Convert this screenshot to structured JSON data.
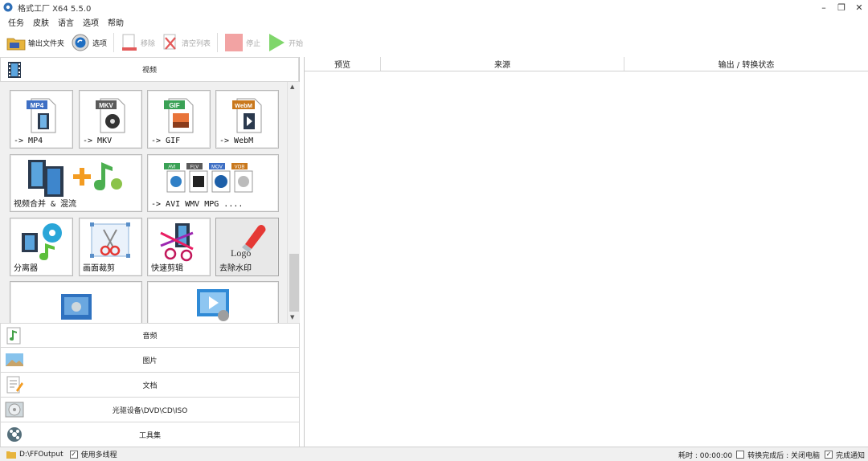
{
  "window": {
    "title": "格式工厂 X64 5.5.0",
    "controls": {
      "minimize": "–",
      "restore": "❐",
      "close": "✕"
    }
  },
  "menu": [
    "任务",
    "皮肤",
    "语言",
    "选项",
    "帮助"
  ],
  "toolbar": {
    "output_folder": "输出文件夹",
    "options": "选项",
    "remove": "移除",
    "clear_list": "清空列表",
    "stop": "停止",
    "start": "开始"
  },
  "sidebar": {
    "video_category": "视频",
    "tiles": [
      {
        "label": "-> MP4",
        "badge": "MP4",
        "badge_color": "#3e6fc4"
      },
      {
        "label": "-> MKV",
        "badge": "MKV",
        "badge_color": "#5a5a5a"
      },
      {
        "label": "-> GIF",
        "badge": "GIF",
        "badge_color": "#3aa155"
      },
      {
        "label": "-> WebM",
        "badge": "WebM",
        "badge_color": "#c9781c"
      },
      {
        "label": "视频合并 & 混流"
      },
      {
        "label": "-> AVI WMV MPG ....",
        "badges": [
          "AVI",
          "FLV",
          "MOV",
          "VOB"
        ]
      },
      {
        "label": "分离器"
      },
      {
        "label": "画面裁剪"
      },
      {
        "label": "快速剪辑"
      },
      {
        "label": "去除水印",
        "logo_text": "Logo"
      },
      {
        "label": ""
      },
      {
        "label": ""
      }
    ],
    "categories": [
      {
        "label": "音频",
        "icon": "music-note-icon"
      },
      {
        "label": "图片",
        "icon": "picture-icon"
      },
      {
        "label": "文档",
        "icon": "document-icon"
      },
      {
        "label": "光驱设备\\DVD\\CD\\ISO",
        "icon": "disc-icon"
      },
      {
        "label": "工具集",
        "icon": "tools-icon"
      }
    ]
  },
  "task_list": {
    "columns": [
      "预览",
      "来源",
      "输出 / 转换状态"
    ]
  },
  "status": {
    "output_path": "D:\\FFOutput",
    "multithread_label": "使用多线程",
    "multithread_checked": true,
    "elapsed": "耗时 : 00:00:00",
    "after_done_label": "转换完成后 : 关闭电脑",
    "after_done_checked": false,
    "notify_label": "完成通知",
    "notify_checked": true
  },
  "colors": {
    "accent_blue": "#3e6fc4",
    "stop_red": "#f2a3a3",
    "start_green": "#7fd66b",
    "statusbar_bg": "#f0f0f0"
  }
}
